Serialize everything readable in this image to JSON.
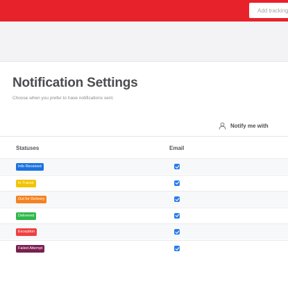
{
  "header": {
    "tracking_placeholder": "Add tracking"
  },
  "main": {
    "title": "Notification Settings",
    "subtitle": "Choose when you prefer to have notifications sent.",
    "notify_label": "Notify me with"
  },
  "table": {
    "col_statuses": "Statuses",
    "col_email": "Email",
    "rows": [
      {
        "label": "Info Received",
        "color": "#1a73e0",
        "email_checked": true
      },
      {
        "label": "In Transit",
        "color": "#f2c400",
        "email_checked": true
      },
      {
        "label": "Out for Delivery",
        "color": "#f58220",
        "email_checked": true
      },
      {
        "label": "Delivered",
        "color": "#2fb84a",
        "email_checked": true
      },
      {
        "label": "Exception",
        "color": "#ef4040",
        "email_checked": true
      },
      {
        "label": "Failed Attempt",
        "color": "#7a1f4f",
        "email_checked": true
      }
    ]
  },
  "colors": {
    "brand_red": "#e8222b",
    "checkbox_blue": "#2b7de9"
  },
  "icons": {
    "notify": "user-icon",
    "checkbox": "check-icon"
  }
}
